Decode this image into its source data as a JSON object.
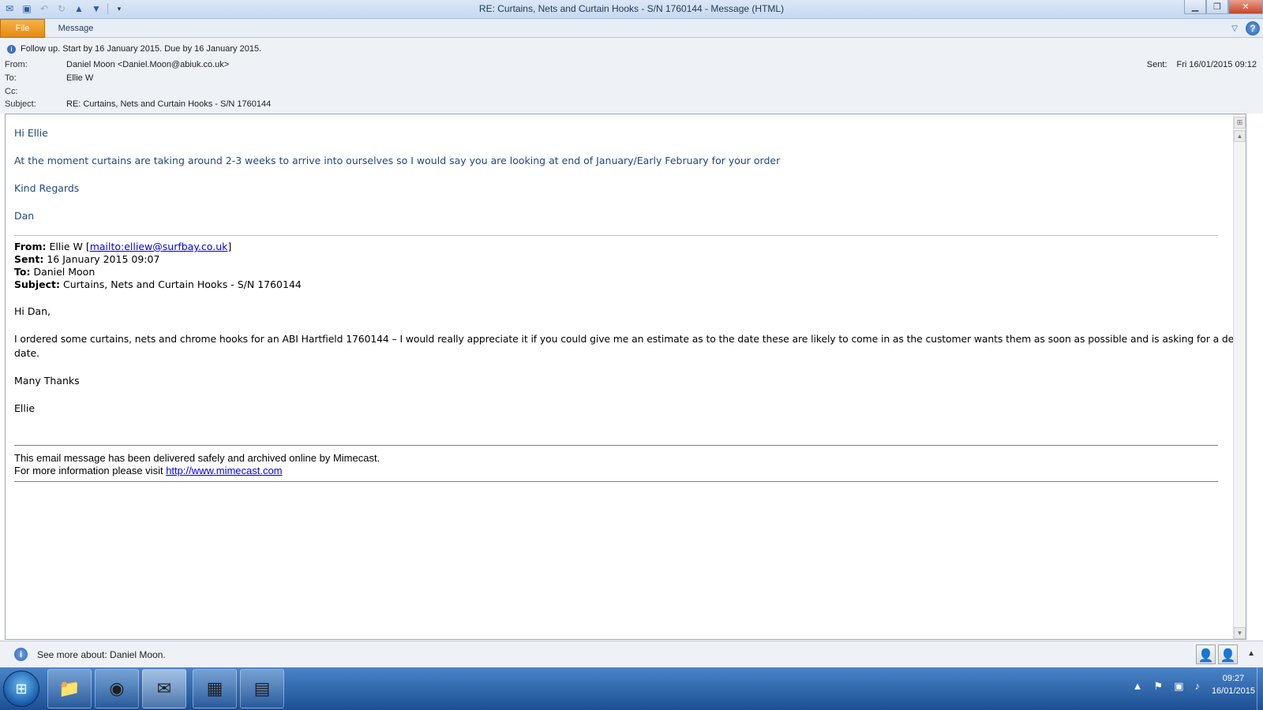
{
  "window": {
    "title": "RE: Curtains, Nets and Curtain Hooks - S/N 1760144  -  Message (HTML)"
  },
  "ribbon": {
    "file_tab": "File",
    "message_tab": "Message"
  },
  "header": {
    "followup": "Follow up.  Start by 16 January 2015.  Due by 16 January 2015.",
    "from_label": "From:",
    "from_value": "Daniel Moon <Daniel.Moon@abiuk.co.uk>",
    "to_label": "To:",
    "to_value": "Ellie W",
    "cc_label": "Cc:",
    "cc_value": "",
    "subject_label": "Subject:",
    "subject_value": "RE: Curtains, Nets and Curtain Hooks - S/N 1760144",
    "sent_label": "Sent:",
    "sent_value": "Fri 16/01/2015 09:12"
  },
  "reply": {
    "greeting": "Hi Ellie",
    "body": "At the moment curtains are taking around 2-3 weeks to arrive into ourselves so I would say you are looking at end of January/Early February for your order",
    "closing": "Kind Regards",
    "signature": "Dan"
  },
  "quoted": {
    "from_label": "From:",
    "from_name": "Ellie W [",
    "from_link": "mailto:elliew@surfbay.co.uk",
    "from_end": "]",
    "sent_label": "Sent:",
    "sent_value": "16 January 2015 09:07",
    "to_label": "To:",
    "to_value": "Daniel Moon",
    "subject_label": "Subject:",
    "subject_value": "Curtains, Nets and Curtain Hooks - S/N 1760144",
    "greeting": "Hi Dan,",
    "body_line1": "I ordered some curtains, nets and chrome hooks for an ABI Hartfield 1760144 – I would really appreciate it if you could give me an estimate as to the date these are likely to come in as the customer wants them as soon as possible and is asking for a delivery",
    "body_line2": "date.",
    "closing": "Many Thanks",
    "signature": "Ellie"
  },
  "mimecast": {
    "line1": "This email message has been delivered safely and archived online by Mimecast.",
    "line2_prefix": "For more information please visit ",
    "link": "http://www.mimecast.com"
  },
  "people_pane": {
    "text": "See more about: Daniel Moon."
  },
  "taskbar": {
    "time": "09:27",
    "date": "16/01/2015",
    "apps": [
      "windows-explorer",
      "google-chrome",
      "outlook",
      "calendar-app",
      "pdf-app"
    ]
  },
  "colors": {
    "reply_text": "#1f497d",
    "file_tab": "#e38a12",
    "link": "#0000ee"
  }
}
